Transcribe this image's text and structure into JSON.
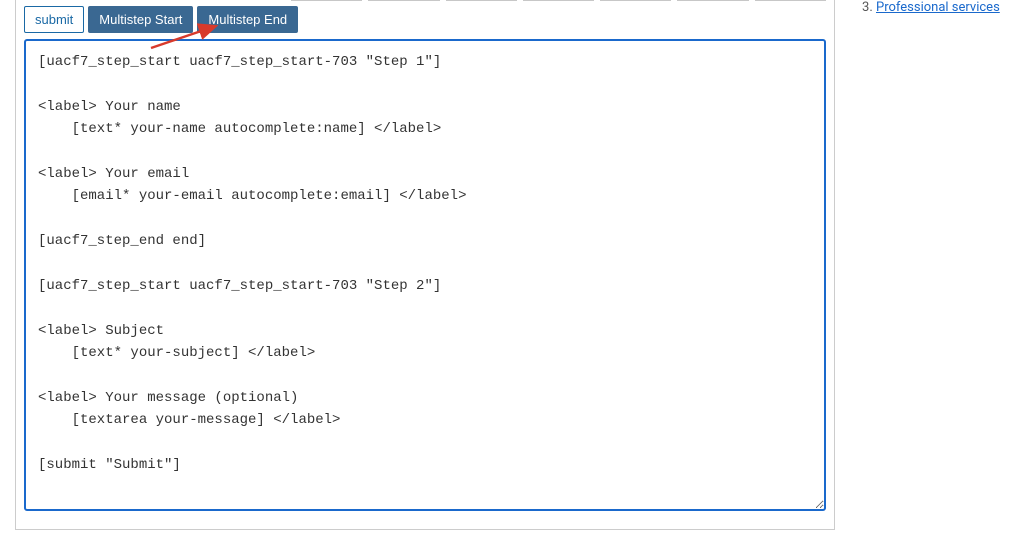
{
  "toolbar": {
    "submit_label": "submit",
    "multistep_start_label": "Multistep Start",
    "multistep_end_label": "Multistep End"
  },
  "form_content": "[uacf7_step_start uacf7_step_start-703 \"Step 1\"]\n\n<label> Your name\n    [text* your-name autocomplete:name] </label>\n\n<label> Your email\n    [email* your-email autocomplete:email] </label>\n\n[uacf7_step_end end]\n\n[uacf7_step_start uacf7_step_start-703 \"Step 2\"]\n\n<label> Subject\n    [text* your-subject] </label>\n\n<label> Your message (optional)\n    [textarea your-message] </label>\n\n[submit \"Submit\"]\n",
  "sidebar": {
    "items": [
      {
        "number": 3,
        "label": "Professional services"
      }
    ]
  }
}
